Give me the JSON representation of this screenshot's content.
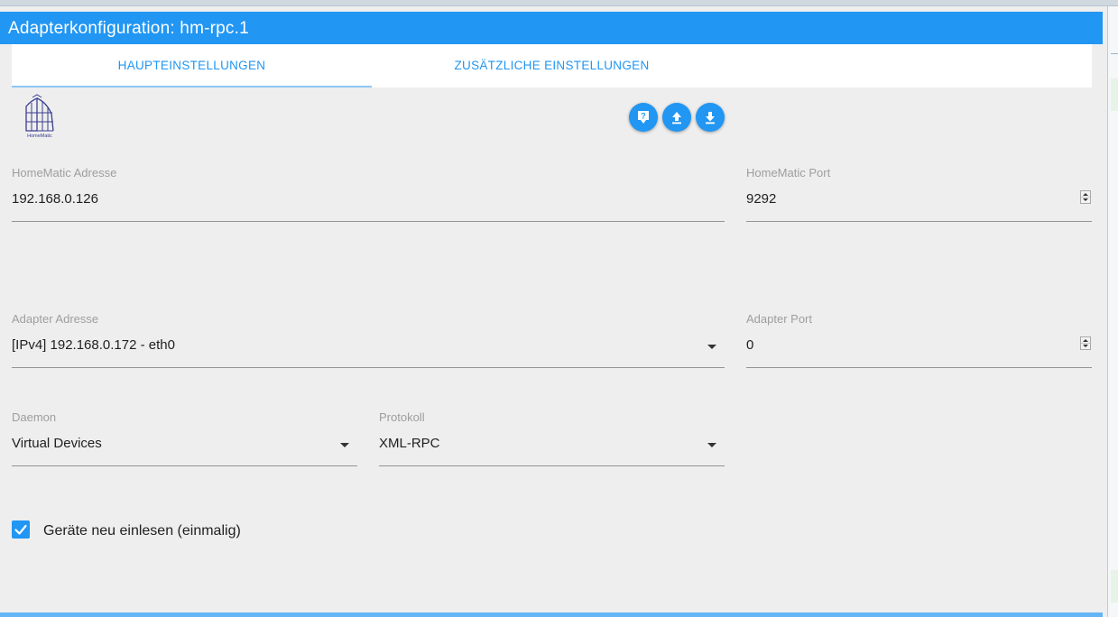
{
  "dialog": {
    "title": "Adapterkonfiguration: hm-rpc.1"
  },
  "tabs": [
    {
      "label": "HAUPTEINSTELLUNGEN",
      "active": true
    },
    {
      "label": "ZUSÄTZLICHE EINSTELLUNGEN",
      "active": false
    }
  ],
  "logo": {
    "text": "HomeMatic"
  },
  "toolbar": {
    "buttons": [
      {
        "icon": "help-icon"
      },
      {
        "icon": "upload-icon"
      },
      {
        "icon": "download-icon"
      }
    ]
  },
  "fields": {
    "homematic_address": {
      "label": "HomeMatic Adresse",
      "value": "192.168.0.126"
    },
    "homematic_port": {
      "label": "HomeMatic Port",
      "value": "9292"
    },
    "adapter_address": {
      "label": "Adapter Adresse",
      "value": "[IPv4] 192.168.0.172 - eth0"
    },
    "adapter_port": {
      "label": "Adapter Port",
      "value": "0"
    },
    "daemon": {
      "label": "Daemon",
      "value": "Virtual Devices"
    },
    "protocol": {
      "label": "Protokoll",
      "value": "XML-RPC"
    }
  },
  "reread_devices": {
    "label": "Geräte neu einlesen (einmalig)",
    "checked": true
  },
  "colors": {
    "primary": "#2196f3",
    "background": "#eeeeee",
    "label": "#9e9e9e"
  }
}
